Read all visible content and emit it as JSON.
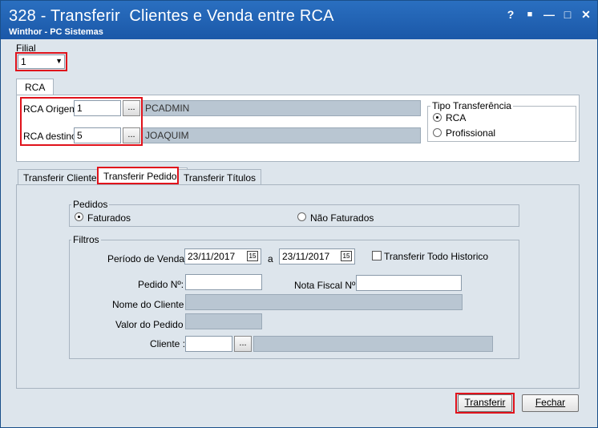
{
  "window": {
    "title": "328 - Transferir  Clientes e Venda entre RCA",
    "subtitle": "Winthor - PC Sistemas",
    "controls": [
      "?",
      "■",
      "—",
      "□",
      "✕"
    ]
  },
  "filial": {
    "label": "Filial",
    "value": "1"
  },
  "rca_tab": {
    "label": "RCA"
  },
  "rca": {
    "origem_label": "RCA Origem",
    "origem_value": "1",
    "origem_name": "PCADMIN",
    "destino_label": "RCA destino",
    "destino_value": "5",
    "destino_name": "JOAQUIM",
    "dots": "..."
  },
  "tipo": {
    "title": "Tipo Transferência",
    "option_rca": "RCA",
    "option_prof": "Profissional",
    "selected": "RCA"
  },
  "tabs": [
    {
      "label": "Transferir Clientes"
    },
    {
      "label": "Transferir Pedidos"
    },
    {
      "label": "Transferir Títulos"
    }
  ],
  "pedidos": {
    "title": "Pedidos",
    "faturados": "Faturados",
    "nao_faturados": "Não Faturados",
    "selected": "Faturados"
  },
  "filtros": {
    "title": "Filtros",
    "periodo_label": "Período de Venda :",
    "date_from": "23/11/2017",
    "a_label": "a",
    "date_to": "23/11/2017",
    "cal": "15",
    "historico_label": "Transferir Todo Historico",
    "pedido_label": "Pedido Nº:",
    "pedido_value": "",
    "nota_label": "Nota Fiscal Nº:",
    "nota_value": "",
    "nome_label": "Nome do Cliente :",
    "valor_label": "Valor do Pedido :",
    "cliente_label": "Cliente :",
    "cliente_value": ""
  },
  "buttons": {
    "transferir": "Transferir",
    "fechar": "Fechar"
  }
}
